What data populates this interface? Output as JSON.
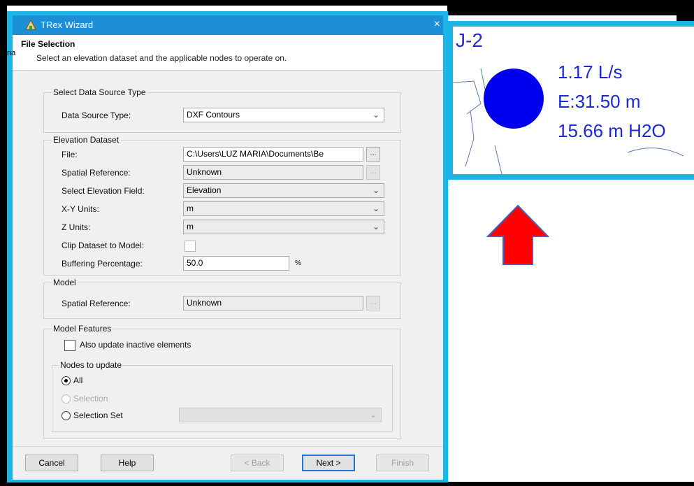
{
  "dialog": {
    "title": "TRex Wizard",
    "close_glyph": "×",
    "edge_text": "na",
    "header": {
      "title": "File Selection",
      "subtitle": "Select an elevation dataset and the applicable nodes to operate on."
    },
    "data_source_group": {
      "title": "Select Data Source Type",
      "type_label": "Data Source Type:",
      "type_value": "DXF Contours"
    },
    "elevation_group": {
      "title": "Elevation Dataset",
      "file_label": "File:",
      "file_value": "C:\\Users\\LUZ MARIA\\Documents\\Be",
      "browse_label": "...",
      "spatial_ref_label": "Spatial Reference:",
      "spatial_ref_value": "Unknown",
      "elev_field_label": "Select Elevation Field:",
      "elev_field_value": "Elevation",
      "xy_units_label": "X-Y Units:",
      "xy_units_value": "m",
      "z_units_label": "Z Units:",
      "z_units_value": "m",
      "clip_label": "Clip Dataset to Model:",
      "clip_checked": false,
      "buffer_label": "Buffering Percentage:",
      "buffer_value": "50.0",
      "buffer_unit": "%"
    },
    "model_group": {
      "title": "Model",
      "spatial_ref_label": "Spatial Reference:",
      "spatial_ref_value": "Unknown"
    },
    "features_group": {
      "title": "Model Features",
      "inactive_label": "Also update inactive elements",
      "inactive_checked": false,
      "nodes_title": "Nodes to update",
      "options": [
        {
          "label": "All",
          "selected": true,
          "enabled": true
        },
        {
          "label": "Selection",
          "selected": false,
          "enabled": false
        },
        {
          "label": "Selection Set",
          "selected": false,
          "enabled": true
        }
      ]
    },
    "buttons": {
      "cancel": "Cancel",
      "help": "Help",
      "back": "< Back",
      "next": "Next >",
      "finish": "Finish"
    }
  },
  "zoom_panel": {
    "node_id": "J-2",
    "flow": "1.17 L/s",
    "elevation": "E:31.50 m",
    "pressure": "15.66 m H2O"
  },
  "colors": {
    "highlight_frame": "#1fb4e8",
    "node_fill": "#0000ee",
    "arrow_fill": "#ff0000",
    "arrow_stroke": "#4a5fc1",
    "titlebar": "#1c8fd8"
  }
}
